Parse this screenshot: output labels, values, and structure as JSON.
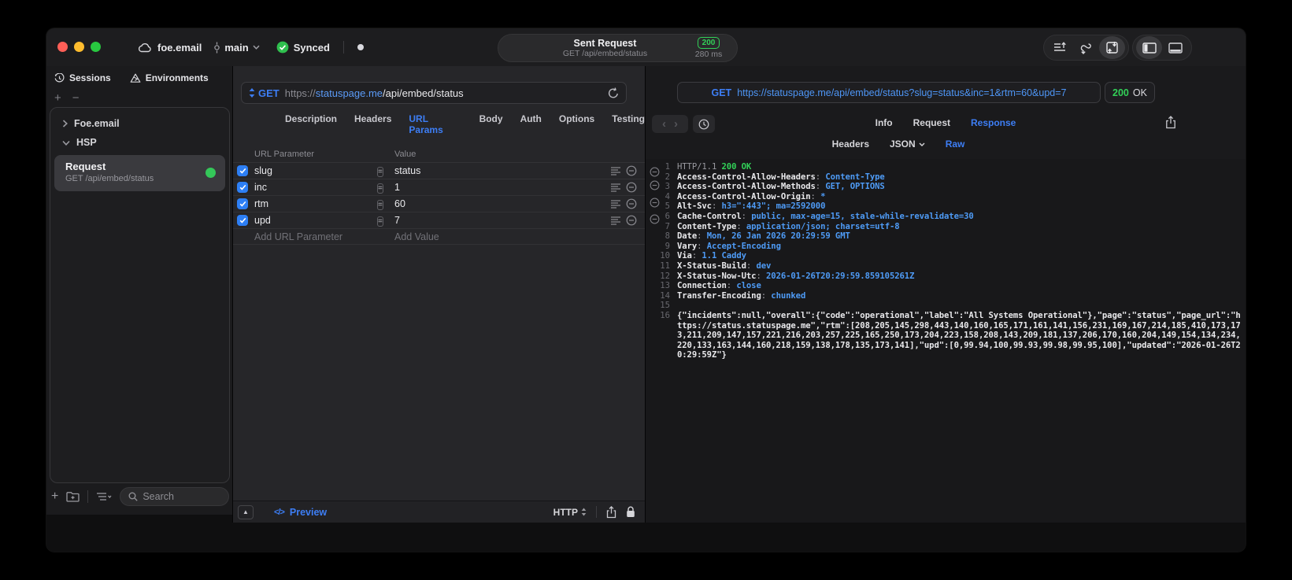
{
  "titlebar": {
    "project": "foe.email",
    "branch": "main",
    "sync_label": "Synced",
    "title": "Sent Request",
    "subtitle": "GET /api/embed/status",
    "status_code": "200",
    "duration": "280 ms"
  },
  "sidebar": {
    "tab_sessions": "Sessions",
    "tab_environments": "Environments",
    "add_label": "+",
    "remove_label": "−",
    "tree_group_1": "Foe.email",
    "tree_group_2": "HSP",
    "request_title": "Request",
    "request_subtitle": "GET /api/embed/status",
    "search_placeholder": "Search"
  },
  "request": {
    "method": "GET",
    "url_scheme": "https://",
    "url_host": "statuspage.me",
    "url_path": "/api/embed/status",
    "tabs": [
      "Description",
      "Headers",
      "URL Params",
      "Body",
      "Auth",
      "Options",
      "Testing"
    ],
    "active_tab": "URL Params",
    "table": {
      "col_name": "URL Parameter",
      "col_value": "Value",
      "rows": [
        {
          "name": "slug",
          "value": "status",
          "enabled": true
        },
        {
          "name": "inc",
          "value": "1",
          "enabled": true
        },
        {
          "name": "rtm",
          "value": "60",
          "enabled": true
        },
        {
          "name": "upd",
          "value": "7",
          "enabled": true
        }
      ],
      "add_name_placeholder": "Add URL Parameter",
      "add_value_placeholder": "Add Value"
    },
    "footer": {
      "code_glyph": "</>",
      "preview_label": "Preview",
      "protocol": "HTTP"
    }
  },
  "response": {
    "method": "GET",
    "url": "https://statuspage.me/api/embed/status?slug=status&inc=1&rtm=60&upd=7",
    "status_code": "200",
    "status_text": "OK",
    "back_glyph": "‹",
    "forward_glyph": "›",
    "tabs": [
      "Info",
      "Request",
      "Response"
    ],
    "active_tab": "Response",
    "subtabs": [
      "Headers",
      "JSON",
      "Raw"
    ],
    "active_subtab": "Raw",
    "lines": [
      {
        "n": "1",
        "parts": [
          [
            "HTTP/1.1 ",
            "dim"
          ],
          [
            "200 OK",
            "green"
          ]
        ]
      },
      {
        "n": "2",
        "parts": [
          [
            "Access-Control-Allow-Headers",
            "key"
          ],
          [
            ": ",
            "dim"
          ],
          [
            "Content-Type",
            "val"
          ]
        ]
      },
      {
        "n": "3",
        "parts": [
          [
            "Access-Control-Allow-Methods",
            "key"
          ],
          [
            ": ",
            "dim"
          ],
          [
            "GET, OPTIONS",
            "val"
          ]
        ]
      },
      {
        "n": "4",
        "parts": [
          [
            "Access-Control-Allow-Origin",
            "key"
          ],
          [
            ": ",
            "dim"
          ],
          [
            "*",
            "val"
          ]
        ]
      },
      {
        "n": "5",
        "parts": [
          [
            "Alt-Svc",
            "key"
          ],
          [
            ": ",
            "dim"
          ],
          [
            "h3=\":443\"; ma=2592000",
            "val"
          ]
        ]
      },
      {
        "n": "6",
        "parts": [
          [
            "Cache-Control",
            "key"
          ],
          [
            ": ",
            "dim"
          ],
          [
            "public, max-age=15, stale-while-revalidate=30",
            "val"
          ]
        ]
      },
      {
        "n": "7",
        "parts": [
          [
            "Content-Type",
            "key"
          ],
          [
            ": ",
            "dim"
          ],
          [
            "application/json; charset=utf-8",
            "val"
          ]
        ]
      },
      {
        "n": "8",
        "parts": [
          [
            "Date",
            "key"
          ],
          [
            ": ",
            "dim"
          ],
          [
            "Mon, 26 Jan 2026 20:29:59 GMT",
            "val"
          ]
        ]
      },
      {
        "n": "9",
        "parts": [
          [
            "Vary",
            "key"
          ],
          [
            ": ",
            "dim"
          ],
          [
            "Accept-Encoding",
            "val"
          ]
        ]
      },
      {
        "n": "10",
        "parts": [
          [
            "Via",
            "key"
          ],
          [
            ": ",
            "dim"
          ],
          [
            "1.1 Caddy",
            "val"
          ]
        ]
      },
      {
        "n": "11",
        "parts": [
          [
            "X-Status-Build",
            "key"
          ],
          [
            ": ",
            "dim"
          ],
          [
            "dev",
            "val"
          ]
        ]
      },
      {
        "n": "12",
        "parts": [
          [
            "X-Status-Now-Utc",
            "key"
          ],
          [
            ": ",
            "dim"
          ],
          [
            "2026-01-26T20:29:59.859105261Z",
            "val"
          ]
        ]
      },
      {
        "n": "13",
        "parts": [
          [
            "Connection",
            "key"
          ],
          [
            ": ",
            "dim"
          ],
          [
            "close",
            "val"
          ]
        ]
      },
      {
        "n": "14",
        "parts": [
          [
            "Transfer-Encoding",
            "key"
          ],
          [
            ": ",
            "dim"
          ],
          [
            "chunked",
            "val"
          ]
        ]
      },
      {
        "n": "15",
        "parts": []
      },
      {
        "n": "16",
        "parts": [
          [
            "{\"incidents\":null,\"overall\":{\"code\":\"operational\",\"label\":\"All Systems Operational\"},\"page\":\"status\",\"page_url\":\"https://status.statuspage.me\",\"rtm\":[208,205,145,298,443,140,160,165,171,161,141,156,231,169,167,214,185,410,173,173,211,209,147,157,221,216,203,257,225,165,250,173,204,223,158,208,143,209,181,137,206,170,160,204,149,154,134,234,220,133,163,144,160,218,159,138,178,135,173,141],\"upd\":[0,99.94,100,99.93,99.98,99.95,100],\"updated\":\"2026-01-26T20:29:59Z\"}",
            "plain"
          ]
        ]
      }
    ]
  }
}
